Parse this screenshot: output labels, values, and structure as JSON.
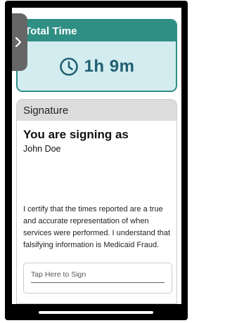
{
  "total_time": {
    "header": "Total Time",
    "value": "1h 9m",
    "icon": "clock-icon"
  },
  "side_handle": {
    "icon": "chevron-right-icon"
  },
  "signature": {
    "header": "Signature",
    "title": "You are signing as",
    "name": "John Doe",
    "certification": "I certify that the times reported are a true and accurate representation of when services were performed. I understand that falsifying information is Medicaid Fraud.",
    "sign_placeholder": "Tap Here to Sign"
  },
  "colors": {
    "teal": "#2f8f84",
    "time_card_bg": "#d3ecef",
    "time_text": "#1f5f72"
  }
}
